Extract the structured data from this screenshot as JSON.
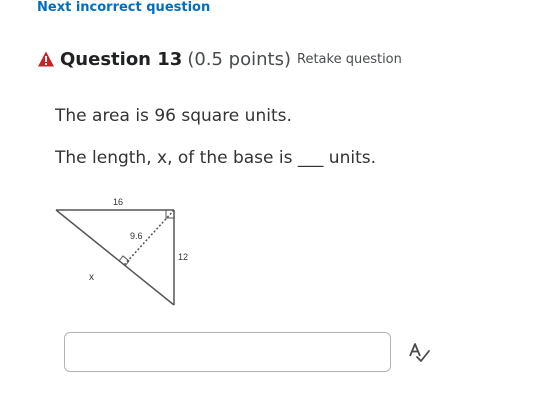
{
  "nav": {
    "next_incorrect_label": "Next incorrect question"
  },
  "question": {
    "title": "Question 13",
    "points": "(0.5 points)",
    "retake_label": "Retake question",
    "line1": "The area is 96 square units.",
    "line2": "The length, x, of the base is ___ units."
  },
  "figure": {
    "top_side_label": "16",
    "altitude_label": "9.6",
    "right_side_label": "12",
    "base_label": "x"
  },
  "answer": {
    "value": "",
    "placeholder": ""
  },
  "icons": {
    "warning": "warning-triangle-icon",
    "spellcheck": "spellcheck-icon"
  },
  "colors": {
    "link": "#006fbf",
    "warning": "#cd2026",
    "title": "#202122",
    "text": "#494c4e"
  }
}
